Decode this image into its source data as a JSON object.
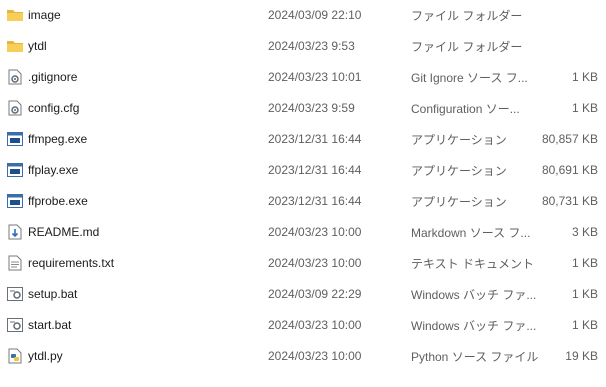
{
  "files": [
    {
      "name": "image",
      "date": "2024/03/09 22:10",
      "type": "ファイル フォルダー",
      "size": "",
      "icon": "folder-icon"
    },
    {
      "name": "ytdl",
      "date": "2024/03/23 9:53",
      "type": "ファイル フォルダー",
      "size": "",
      "icon": "folder-icon"
    },
    {
      "name": ".gitignore",
      "date": "2024/03/23 10:01",
      "type": "Git Ignore ソース フ...",
      "size": "1 KB",
      "icon": "gear-file-icon"
    },
    {
      "name": "config.cfg",
      "date": "2024/03/23 9:59",
      "type": "Configuration ソー...",
      "size": "1 KB",
      "icon": "gear-file-icon"
    },
    {
      "name": "ffmpeg.exe",
      "date": "2023/12/31 16:44",
      "type": "アプリケーション",
      "size": "80,857 KB",
      "icon": "application-icon"
    },
    {
      "name": "ffplay.exe",
      "date": "2023/12/31 16:44",
      "type": "アプリケーション",
      "size": "80,691 KB",
      "icon": "application-icon"
    },
    {
      "name": "ffprobe.exe",
      "date": "2023/12/31 16:44",
      "type": "アプリケーション",
      "size": "80,731 KB",
      "icon": "application-icon"
    },
    {
      "name": "README.md",
      "date": "2024/03/23 10:00",
      "type": "Markdown ソース フ...",
      "size": "3 KB",
      "icon": "markdown-file-icon"
    },
    {
      "name": "requirements.txt",
      "date": "2024/03/23 10:00",
      "type": "テキスト ドキュメント",
      "size": "1 KB",
      "icon": "text-file-icon"
    },
    {
      "name": "setup.bat",
      "date": "2024/03/09 22:29",
      "type": "Windows バッチ ファ...",
      "size": "1 KB",
      "icon": "batch-file-icon"
    },
    {
      "name": "start.bat",
      "date": "2024/03/23 10:00",
      "type": "Windows バッチ ファ...",
      "size": "1 KB",
      "icon": "batch-file-icon"
    },
    {
      "name": "ytdl.py",
      "date": "2024/03/23 10:00",
      "type": "Python ソース ファイル",
      "size": "19 KB",
      "icon": "python-file-icon"
    }
  ]
}
